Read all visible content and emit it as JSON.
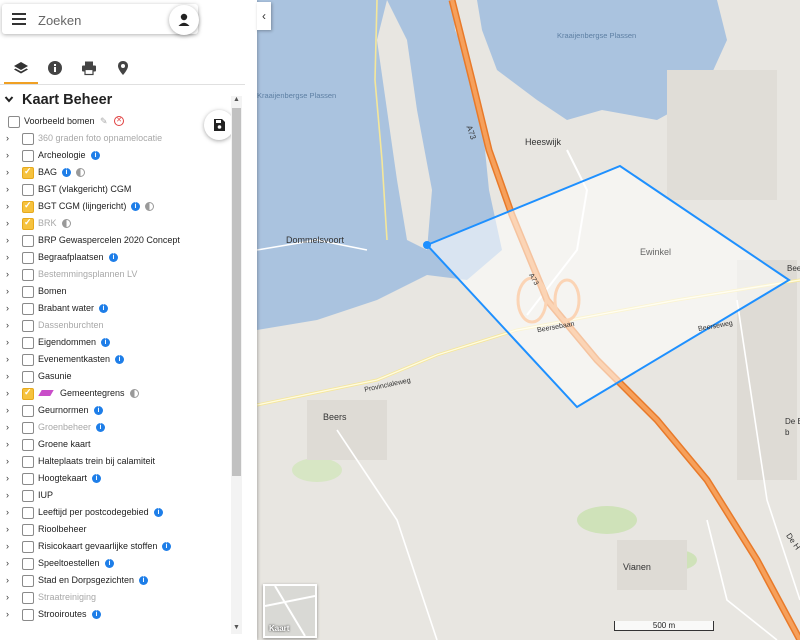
{
  "search": {
    "placeholder": "Zoeken"
  },
  "icons": {
    "menu": "hamburger-icon",
    "user": "user-icon",
    "layers_tab": "layers-icon",
    "info_tab": "info-icon",
    "print_tab": "print-icon",
    "location_tab": "map-pin-icon",
    "save": "floppy-disk-icon",
    "collapse": "chevron-left-icon"
  },
  "colors": {
    "accent": "#f0a023",
    "checkbox_on": "#f6c23e",
    "info_badge": "#1e7ee8",
    "selection_polygon": "#1e90ff",
    "motorway": "#f28f3b",
    "water": "#aac3df"
  },
  "section": {
    "title": "Kaart Beheer"
  },
  "layers": [
    {
      "label": "Voorbeeld bomen",
      "checked": false,
      "disabled": false,
      "expandable": false,
      "extras": [
        "pencil",
        "remove"
      ]
    },
    {
      "label": "360 graden foto opnamelocatie",
      "checked": false,
      "disabled": true,
      "expandable": true,
      "extras": []
    },
    {
      "label": "Archeologie",
      "checked": false,
      "disabled": false,
      "expandable": true,
      "extras": [
        "info"
      ]
    },
    {
      "label": "BAG",
      "checked": true,
      "disabled": false,
      "expandable": true,
      "extras": [
        "info",
        "opacity"
      ]
    },
    {
      "label": "BGT (vlakgericht) CGM",
      "checked": false,
      "disabled": false,
      "expandable": true,
      "extras": []
    },
    {
      "label": "BGT CGM (lijngericht)",
      "checked": true,
      "disabled": false,
      "expandable": true,
      "extras": [
        "info",
        "opacity"
      ]
    },
    {
      "label": "BRK",
      "checked": true,
      "disabled": true,
      "expandable": true,
      "extras": [
        "opacity"
      ]
    },
    {
      "label": "BRP Gewaspercelen 2020 Concept",
      "checked": false,
      "disabled": false,
      "expandable": true,
      "extras": []
    },
    {
      "label": "Begraafplaatsen",
      "checked": false,
      "disabled": false,
      "expandable": true,
      "extras": [
        "info"
      ]
    },
    {
      "label": "Bestemmingsplannen LV",
      "checked": false,
      "disabled": true,
      "expandable": true,
      "extras": []
    },
    {
      "label": "Bomen",
      "checked": false,
      "disabled": false,
      "expandable": true,
      "extras": []
    },
    {
      "label": "Brabant water",
      "checked": false,
      "disabled": false,
      "expandable": true,
      "extras": [
        "info"
      ]
    },
    {
      "label": "Dassenburchten",
      "checked": false,
      "disabled": true,
      "expandable": true,
      "extras": []
    },
    {
      "label": "Eigendommen",
      "checked": false,
      "disabled": false,
      "expandable": true,
      "extras": [
        "info"
      ]
    },
    {
      "label": "Evenementkasten",
      "checked": false,
      "disabled": false,
      "expandable": true,
      "extras": [
        "info"
      ]
    },
    {
      "label": "Gasunie",
      "checked": false,
      "disabled": false,
      "expandable": true,
      "extras": []
    },
    {
      "label": "Gemeentegrens",
      "checked": true,
      "disabled": false,
      "expandable": true,
      "extras": [
        "swatch",
        "opacity"
      ]
    },
    {
      "label": "Geurnormen",
      "checked": false,
      "disabled": false,
      "expandable": true,
      "extras": [
        "info"
      ]
    },
    {
      "label": "Groenbeheer",
      "checked": false,
      "disabled": true,
      "expandable": true,
      "extras": [
        "info"
      ]
    },
    {
      "label": "Groene kaart",
      "checked": false,
      "disabled": false,
      "expandable": true,
      "extras": []
    },
    {
      "label": "Halteplaats trein bij calamiteit",
      "checked": false,
      "disabled": false,
      "expandable": true,
      "extras": []
    },
    {
      "label": "Hoogtekaart",
      "checked": false,
      "disabled": false,
      "expandable": true,
      "extras": [
        "info"
      ]
    },
    {
      "label": "IUP",
      "checked": false,
      "disabled": false,
      "expandable": true,
      "extras": []
    },
    {
      "label": "Leeftijd per postcodegebied",
      "checked": false,
      "disabled": false,
      "expandable": true,
      "extras": [
        "info"
      ]
    },
    {
      "label": "Rioolbeheer",
      "checked": false,
      "disabled": false,
      "expandable": true,
      "extras": []
    },
    {
      "label": "Risicokaart gevaarlijke stoffen",
      "checked": false,
      "disabled": false,
      "expandable": true,
      "extras": [
        "info"
      ]
    },
    {
      "label": "Speeltoestellen",
      "checked": false,
      "disabled": false,
      "expandable": true,
      "extras": [
        "info"
      ]
    },
    {
      "label": "Stad en Dorpsgezichten",
      "checked": false,
      "disabled": false,
      "expandable": true,
      "extras": [
        "info"
      ]
    },
    {
      "label": "Straatreiniging",
      "checked": false,
      "disabled": true,
      "expandable": true,
      "extras": []
    },
    {
      "label": "Strooiroutes",
      "checked": false,
      "disabled": false,
      "expandable": true,
      "extras": [
        "info"
      ]
    }
  ],
  "map": {
    "places": [
      "Heeswijk",
      "Dommelsvoort",
      "Ewinkel",
      "Beers",
      "Vianen"
    ],
    "water_names": [
      "Kraaijenbergse Plassen",
      "Kraaijenbergse Plassen"
    ],
    "roads": [
      "A73",
      "A73",
      "Beersebaan",
      "Provincialeweg",
      "Beerseweg"
    ],
    "edge_labels": [
      "Beers",
      "De B",
      "b",
      "De H"
    ],
    "basemap_label": "Kaart",
    "scale_label": "500 m"
  }
}
